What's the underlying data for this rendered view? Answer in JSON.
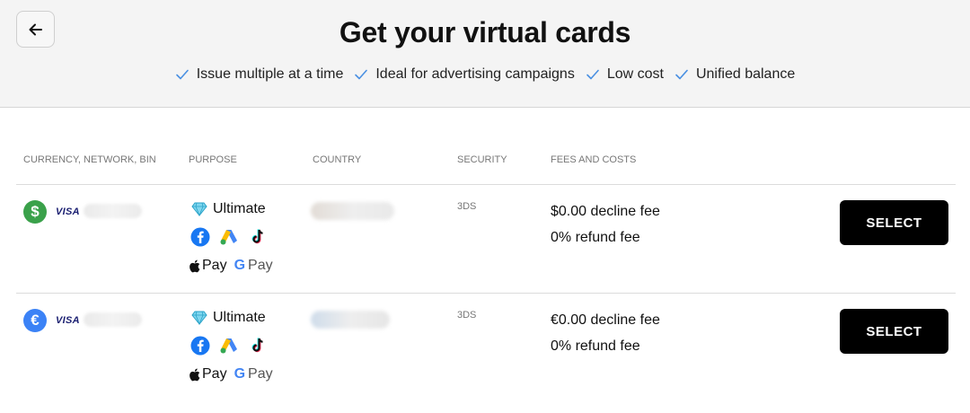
{
  "header": {
    "title": "Get your virtual cards",
    "back_icon": "arrow-left-icon",
    "features": [
      "Issue multiple at a time",
      "Ideal for advertising campaigns",
      "Low cost",
      "Unified balance"
    ]
  },
  "table": {
    "columns": [
      "CURRENCY, NETWORK, BIN",
      "PURPOSE",
      "COUNTRY",
      "SECURITY",
      "FEES AND COSTS"
    ],
    "rows": [
      {
        "currency_symbol": "$",
        "currency_color": "#3aa14a",
        "network": "VISA",
        "purpose": "Ultimate",
        "security": "3DS",
        "fee_decline": "$0.00 decline fee",
        "fee_refund": "0% refund fee",
        "apple_pay": "Pay",
        "google_pay": "Pay",
        "select_label": "SELECT"
      },
      {
        "currency_symbol": "€",
        "currency_color": "#3b82f6",
        "network": "VISA",
        "purpose": "Ultimate",
        "security": "3DS",
        "fee_decline": "€0.00 decline fee",
        "fee_refund": "0% refund fee",
        "apple_pay": "Pay",
        "google_pay": "Pay",
        "select_label": "SELECT"
      }
    ]
  },
  "colors": {
    "accent_check": "#4a90e2",
    "button_bg": "#000000"
  }
}
